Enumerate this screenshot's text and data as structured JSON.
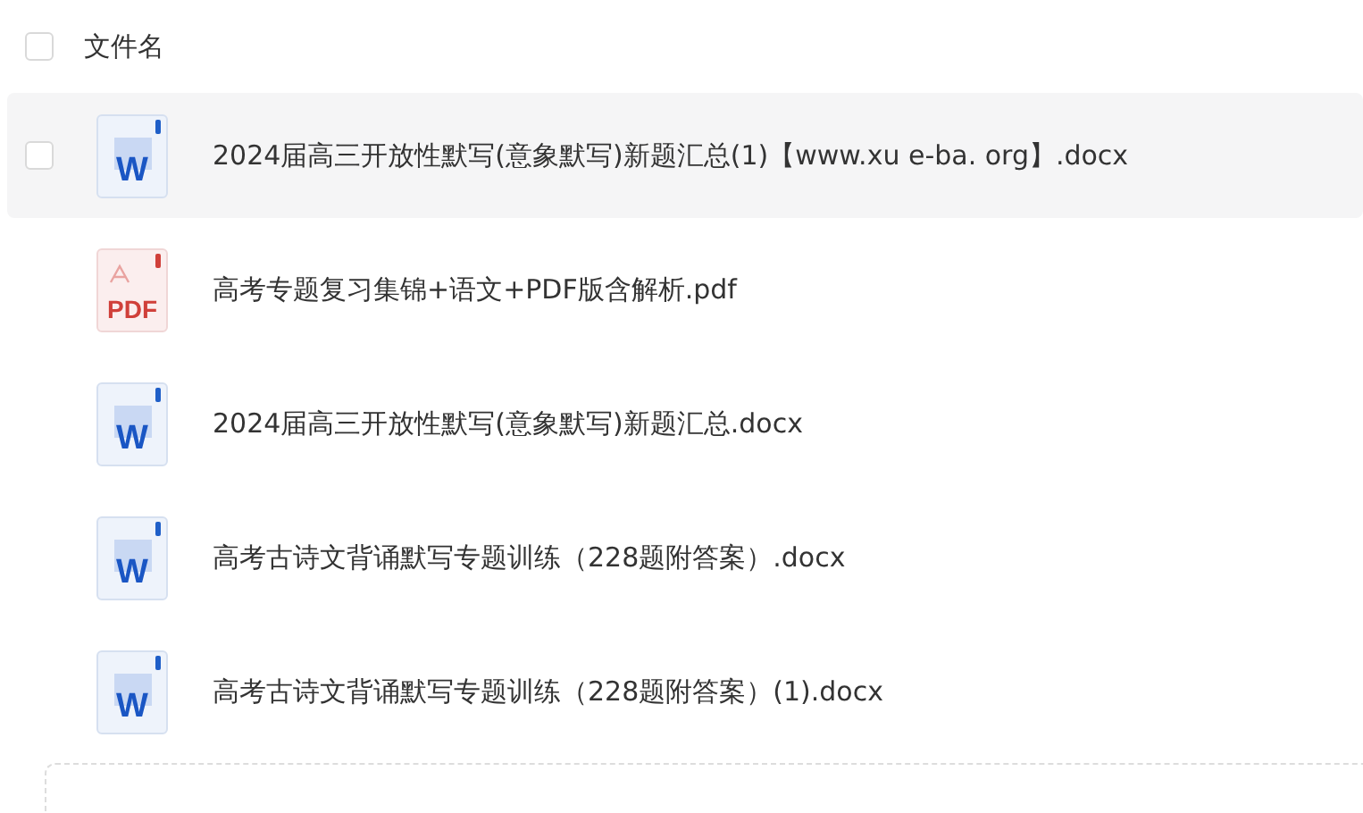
{
  "header": {
    "checked": false,
    "label": "文件名"
  },
  "files": [
    {
      "kind": "word",
      "badge": "W",
      "name": "2024届高三开放性默写(意象默写)新题汇总(1)【www.xu e-ba. org】.docx",
      "hovered": true,
      "checked": false
    },
    {
      "kind": "pdf",
      "badge": "PDF",
      "name": "高考专题复习集锦+语文+PDF版含解析.pdf",
      "hovered": false,
      "checked": false
    },
    {
      "kind": "word",
      "badge": "W",
      "name": "2024届高三开放性默写(意象默写)新题汇总.docx",
      "hovered": false,
      "checked": false
    },
    {
      "kind": "word",
      "badge": "W",
      "name": "高考古诗文背诵默写专题训练（228题附答案）.docx",
      "hovered": false,
      "checked": false
    },
    {
      "kind": "word",
      "badge": "W",
      "name": "高考古诗文背诵默写专题训练（228题附答案）(1).docx",
      "hovered": false,
      "checked": false
    }
  ]
}
